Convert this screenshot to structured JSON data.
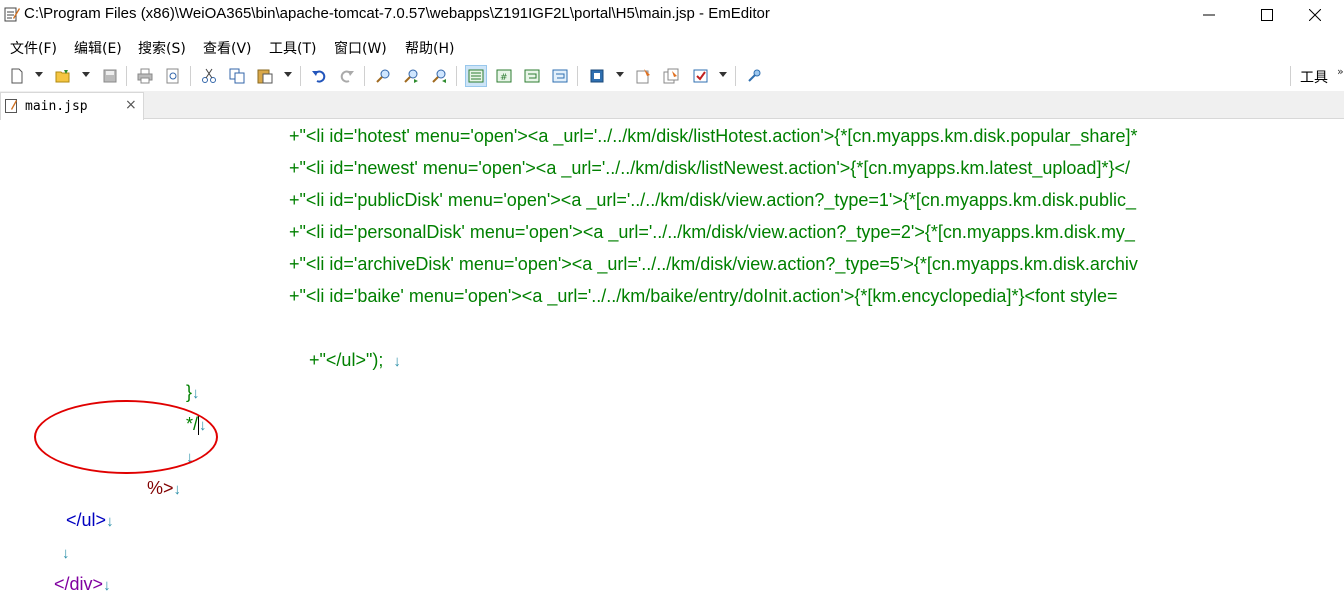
{
  "window": {
    "title": "C:\\Program Files (x86)\\WeiOA365\\bin\\apache-tomcat-7.0.57\\webapps\\Z191IGF2L\\portal\\H5\\main.jsp - EmEditor",
    "app_icon": "emeditor-icon"
  },
  "menu": {
    "items": [
      {
        "label": "文件(F)"
      },
      {
        "label": "编辑(E)"
      },
      {
        "label": "搜索(S)"
      },
      {
        "label": "查看(V)"
      },
      {
        "label": "工具(T)"
      },
      {
        "label": "窗口(W)"
      },
      {
        "label": "帮助(H)"
      }
    ]
  },
  "toolbar": {
    "right_label": "工具",
    "right_arrow": "»",
    "icons": [
      "new-file-icon",
      "open-folder-icon",
      "save-icon",
      "print-icon",
      "print-preview-icon",
      "cut-icon",
      "copy-icon",
      "paste-icon",
      "undo-icon",
      "redo-icon",
      "find-icon",
      "find-next-icon",
      "find-prev-icon",
      "wrap-none-icon",
      "wrap-chars-icon",
      "wrap-window-icon",
      "wrap-page-icon",
      "config-icon",
      "macro-record-icon",
      "macro-run-icon",
      "customize-icon",
      "plugin-icon"
    ]
  },
  "tabs": [
    {
      "label": "main.jsp",
      "close": "×"
    }
  ],
  "editor": {
    "lines": [
      {
        "text": "+\"<li id='hotest' menu='open'><a _url='../../km/disk/listHotest.action'>{*[cn.myapps.km.disk.popular_share]*",
        "class": "str"
      },
      {
        "text": "+\"<li id='newest' menu='open'><a _url='../../km/disk/listNewest.action'>{*[cn.myapps.km.latest_upload]*}</",
        "class": "str"
      },
      {
        "text": "+\"<li id='publicDisk' menu='open'><a _url='../../km/disk/view.action?_type=1'>{*[cn.myapps.km.disk.public_",
        "class": "str"
      },
      {
        "text": "+\"<li id='personalDisk' menu='open'><a _url='../../km/disk/view.action?_type=2'>{*[cn.myapps.km.disk.my_",
        "class": "str"
      },
      {
        "text": "+\"<li id='archiveDisk' menu='open'><a _url='../../km/disk/view.action?_type=5'>{*[cn.myapps.km.disk.archiv",
        "class": "str"
      },
      {
        "text": "+\"<li id='baike' menu='open'><a _url='../../km/baike/entry/doInit.action'>{*[km.encyclopedia]*}<font style=",
        "class": "str"
      },
      {
        "text": "+\"</ul>\");  ",
        "class": "str"
      }
    ],
    "brace_close": "}",
    "comment_close": "*/",
    "jsp_close": "%>",
    "ul_close": "</ul>",
    "div_close": "</div>",
    "newline_mark": "↓"
  },
  "colors": {
    "string_green": "#008000",
    "newline_mark": "#2a8fa8",
    "tag_blue": "#0000c0",
    "tag_purple": "#8000a0",
    "jsp_marker": "#800000",
    "annotation_circle": "#e00000"
  }
}
